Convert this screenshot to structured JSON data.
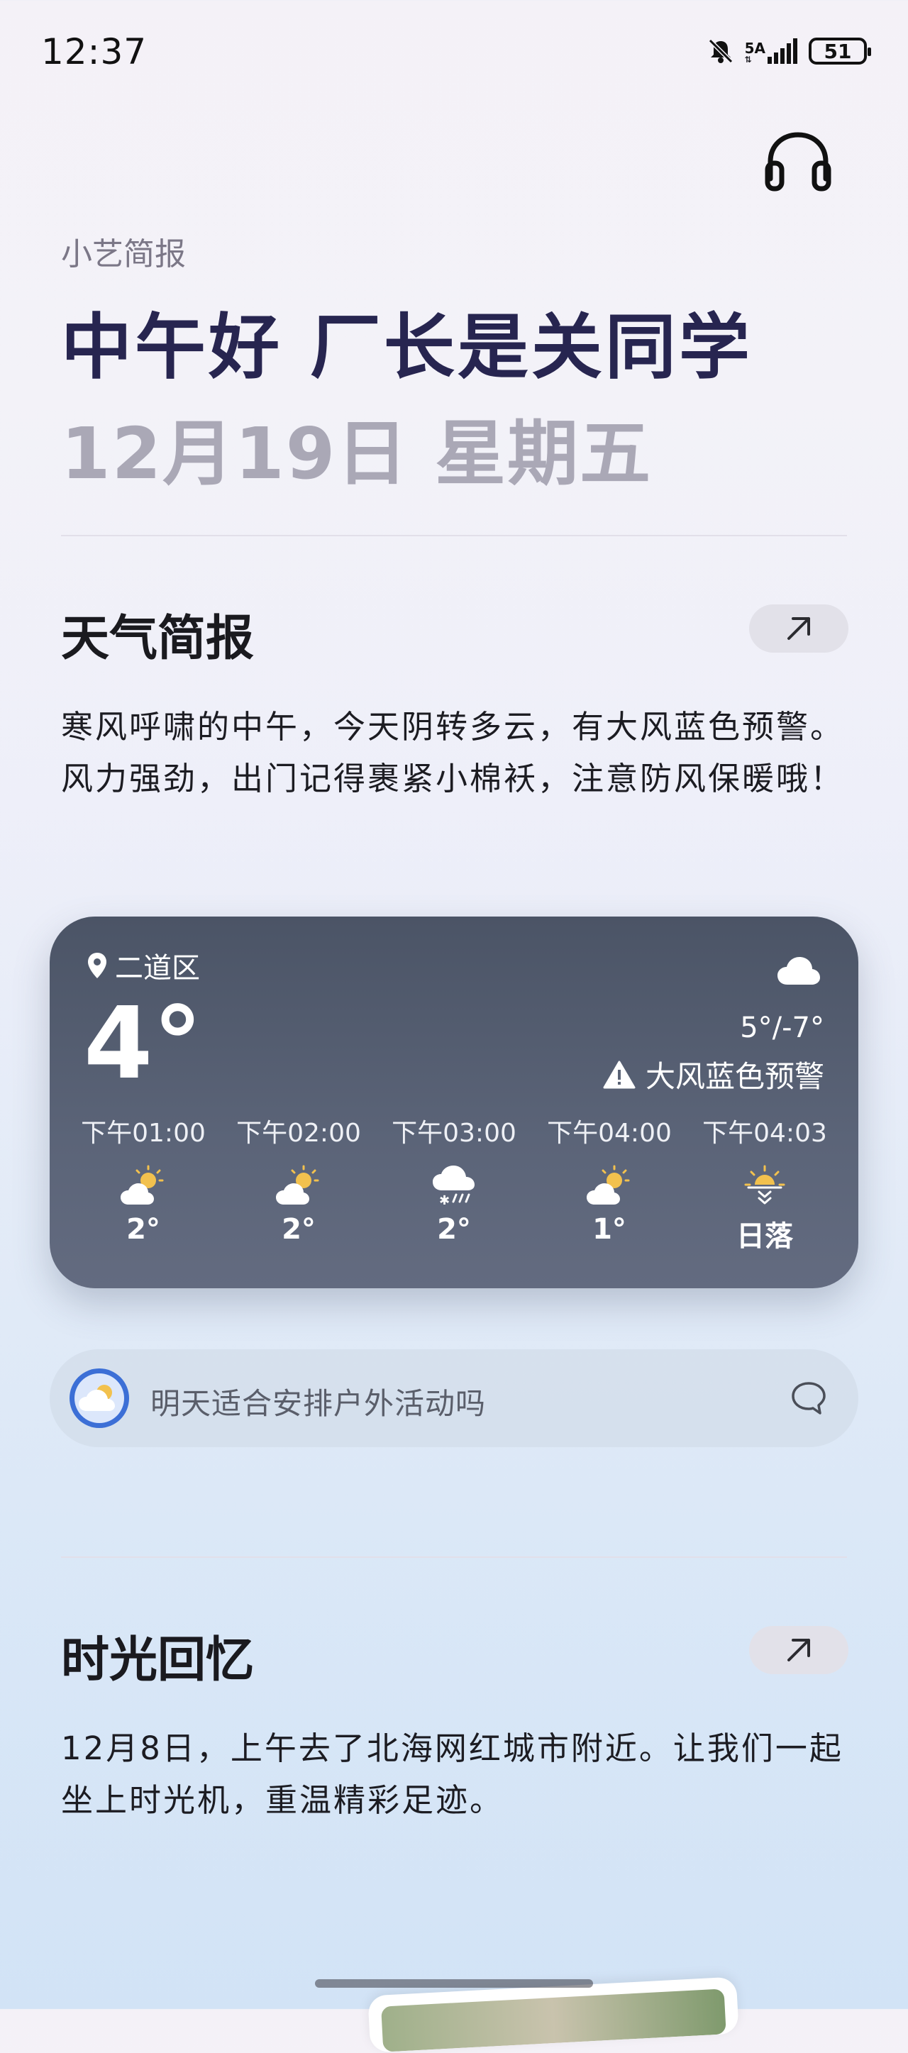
{
  "status_bar": {
    "time": "12:37",
    "network": "5A",
    "battery": "51",
    "icons": [
      "bell-off-icon",
      "signal-icon",
      "battery-icon"
    ]
  },
  "header": {
    "headphone_icon": "headphone-icon",
    "brief_label": "小艺简报",
    "greeting": "中午好 厂长是关同学",
    "date": "12月19日 星期五"
  },
  "weather_section": {
    "title": "天气简报",
    "open_icon": "arrow-up-right-icon",
    "description": "寒风呼啸的中午，今天阴转多云，有大风蓝色预警。风力强劲，出门记得裹紧小棉袄，注意防风保暖哦！",
    "card": {
      "location": "二道区",
      "temperature": "4°",
      "condition_icon": "cloud-icon",
      "range": "5°/-7°",
      "alert": "大风蓝色预警",
      "forecast": [
        {
          "time": "下午01:00",
          "icon": "partly-cloudy-icon",
          "value": "2°"
        },
        {
          "time": "下午02:00",
          "icon": "partly-cloudy-icon",
          "value": "2°"
        },
        {
          "time": "下午03:00",
          "icon": "snow-rain-icon",
          "value": "2°"
        },
        {
          "time": "下午04:00",
          "icon": "partly-cloudy-icon",
          "value": "1°"
        },
        {
          "time": "下午04:03",
          "icon": "sunset-icon",
          "value": "日落"
        }
      ]
    }
  },
  "suggestion": {
    "text": "明天适合安排户外活动吗",
    "icon": "chat-bubble-icon"
  },
  "memory_section": {
    "title": "时光回忆",
    "open_icon": "arrow-up-right-icon",
    "description": "12月8日，上午去了北海网红城市附近。让我们一起坐上时光机，重温精彩足迹。"
  },
  "colors": {
    "greeting": "#272550",
    "date": "#aaa8b6",
    "card_background": "#555e72",
    "sun": "#f2c14e"
  }
}
